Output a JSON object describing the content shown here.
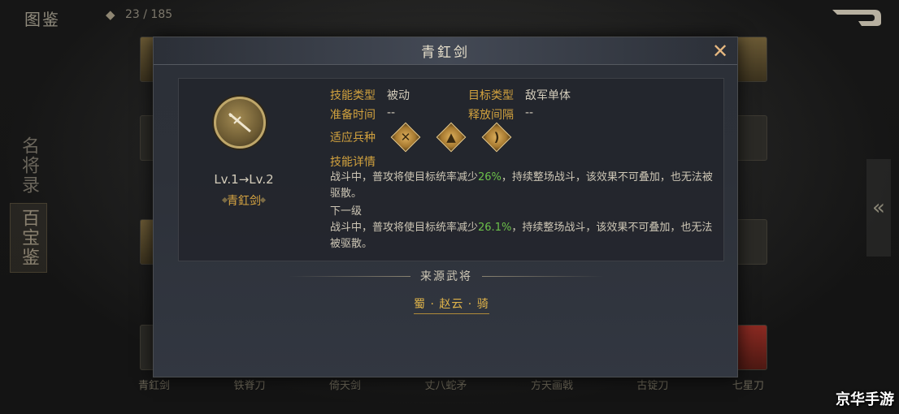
{
  "top_bar": {
    "title": "图鉴",
    "counter": "23 / 185",
    "gem_icon": "gem-icon"
  },
  "side_tabs": [
    {
      "label": "名将录"
    },
    {
      "label": "百宝鉴"
    }
  ],
  "bottom_labels": [
    "青釭剑",
    "铁脊刀",
    "倚天剑",
    "丈八蛇矛",
    "方天画戟",
    "古锭刀",
    "七星刀"
  ],
  "watermark": "京华手游",
  "modal": {
    "title": "青釭剑",
    "level": "Lv.1→Lv.2",
    "name": "青釭剑",
    "attributes": {
      "skill_type_label": "技能类型",
      "skill_type_value": "被动",
      "target_type_label": "目标类型",
      "target_type_value": "敌军单体",
      "prep_time_label": "准备时间",
      "prep_time_value": "--",
      "release_interval_label": "释放间隔",
      "release_interval_value": "--",
      "troop_label": "适应兵种"
    },
    "troop_icons": [
      "crossed-swords-icon",
      "horse-icon",
      "bow-icon"
    ],
    "detail_label": "技能详情",
    "desc_current_pre": "战斗中，普攻将使目标统率减少",
    "desc_current_value": "26%",
    "desc_current_post": "，持续整场战斗，该效果不可叠加，也无法被驱散。",
    "next_level_label": "下一级",
    "desc_next_pre": "战斗中，普攻将使目标统率减少",
    "desc_next_value": "26.1%",
    "desc_next_post": "，持续整场战斗，该效果不可叠加，也无法被驱散。",
    "source_label": "来源武将",
    "general": "蜀 · 赵云 · 骑"
  },
  "colors": {
    "gold": "#d2a23e",
    "green": "#6cc04a",
    "close": "#e6b880"
  }
}
